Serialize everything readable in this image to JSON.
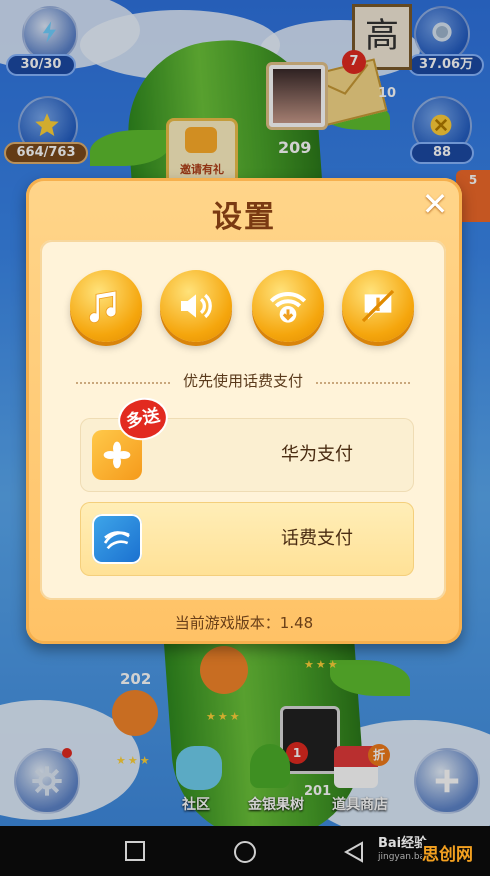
{
  "hud": {
    "energy": "30/30",
    "star_progress": "664/763",
    "coins": "37.06万",
    "gems": "88",
    "mail_count": "7",
    "level_number": "209",
    "board_char": "高",
    "side_text": "10",
    "gift_label": "邀请有礼",
    "right_badge": "5"
  },
  "map": {
    "node_202": "202",
    "node_201": "201",
    "photo_badge": "1",
    "shop_tag": "折"
  },
  "dialog": {
    "title": "设置",
    "close_symbol": "✕",
    "pref_label": "优先使用话费支付",
    "pay_options": [
      {
        "label": "华为支付",
        "badge": "多送"
      },
      {
        "label": "话费支付"
      }
    ],
    "version": "当前游戏版本：1.48"
  },
  "bottom": {
    "community": "社区",
    "money_tree": "金银果树",
    "shop": "道具商店"
  },
  "watermark": {
    "brand": "Bai经验",
    "url": "jingyan.baidu.com",
    "corner": "思创网"
  },
  "colors": {
    "accent": "#f5a60d",
    "title": "#7a3a12"
  }
}
